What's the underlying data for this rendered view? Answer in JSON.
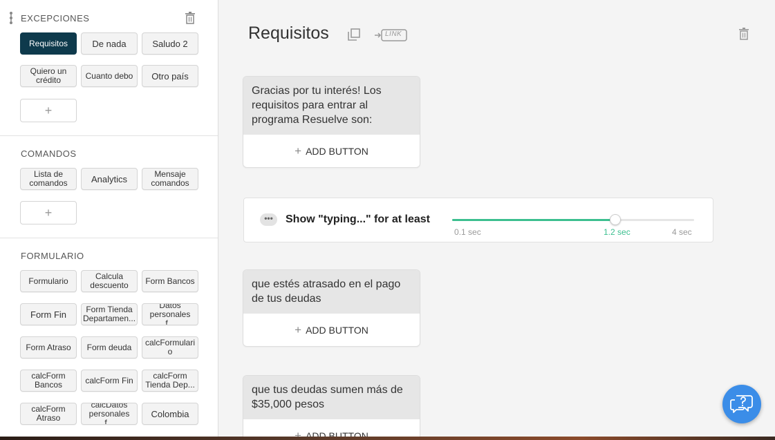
{
  "sidebar": {
    "sections": [
      {
        "title": "EXCEPCIONES",
        "blocks": [
          "Requisitos",
          "De nada",
          "Saludo 2",
          "Quiero un crédito",
          "Cuanto debo",
          "Otro país"
        ],
        "add_label": "+"
      },
      {
        "title": "COMANDOS",
        "blocks": [
          "Lista de comandos",
          "Analytics",
          "Mensaje comandos"
        ],
        "add_label": "+"
      },
      {
        "title": "FORMULARIO",
        "blocks": [
          "Formulario",
          "Calcula descuento",
          "Form Bancos",
          "Form Fin",
          "Form Tienda Departamen...",
          "Datos personales f...",
          "Form Atraso",
          "Form deuda",
          "calcFormulario",
          "calcForm Bancos",
          "calcForm Fin",
          "calcForm Tienda Dep...",
          "calcForm Atraso",
          "calcDatos personales f...",
          "Colombia"
        ]
      }
    ]
  },
  "main": {
    "title": "Requisitos",
    "link_label": "LINK",
    "cards": [
      {
        "text": "Gracias por tu interés! Los requisitos para entrar al programa Resuelve son:",
        "add_button": "ADD BUTTON"
      },
      {
        "text": "que estés atrasado en el pago de tus deudas",
        "add_button": "ADD BUTTON"
      },
      {
        "text": "que tus deudas sumen más de $35,000 pesos",
        "add_button": "ADD BUTTON"
      }
    ],
    "typing": {
      "dots": "•••",
      "label": "Show \"typing...\" for at least",
      "min_label": "0.1 sec",
      "value_label": "1.2 sec",
      "max_label": "4 sec",
      "min": 0.1,
      "max": 4,
      "value": 1.2
    }
  },
  "colors": {
    "active_block": "#0e3a4c",
    "slider_accent": "#3bbf8f",
    "help_button": "#3b8de8"
  }
}
